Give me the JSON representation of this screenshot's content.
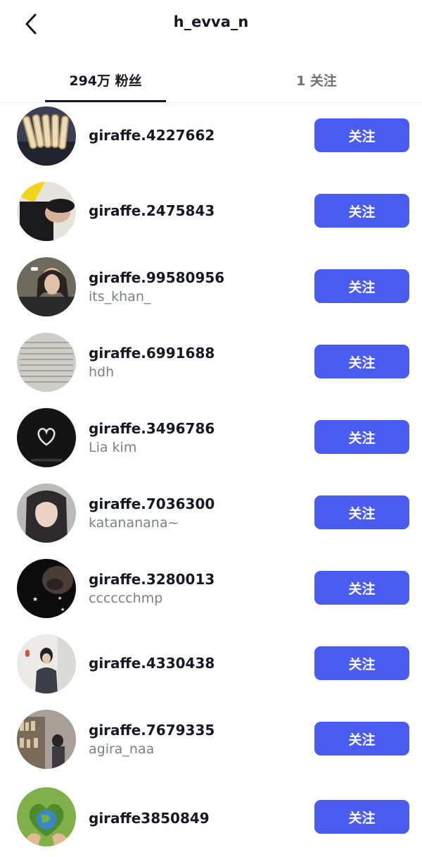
{
  "header": {
    "title": "h_evva_n"
  },
  "tabs": {
    "followers": "294万 粉丝",
    "following": "1 关注"
  },
  "users": [
    {
      "name": "giraffe.4227662",
      "sub": "",
      "button": "关注"
    },
    {
      "name": "giraffe.2475843",
      "sub": "",
      "button": "关注"
    },
    {
      "name": "giraffe.99580956",
      "sub": "its_khan_",
      "button": "关注"
    },
    {
      "name": "giraffe.6991688",
      "sub": "hdh",
      "button": "关注"
    },
    {
      "name": "giraffe.3496786",
      "sub": "Lia kim",
      "button": "关注"
    },
    {
      "name": "giraffe.7036300",
      "sub": "katananana~",
      "button": "关注"
    },
    {
      "name": "giraffe.3280013",
      "sub": "cccccchmp",
      "button": "关注"
    },
    {
      "name": "giraffe.4330438",
      "sub": "",
      "button": "关注"
    },
    {
      "name": "giraffe.7679335",
      "sub": "agira_naa",
      "button": "关注"
    },
    {
      "name": "giraffe3850849",
      "sub": "",
      "button": "关注"
    }
  ],
  "colors": {
    "accent": "#4a5cf0",
    "text": "#161823",
    "muted": "#7c7f86"
  }
}
